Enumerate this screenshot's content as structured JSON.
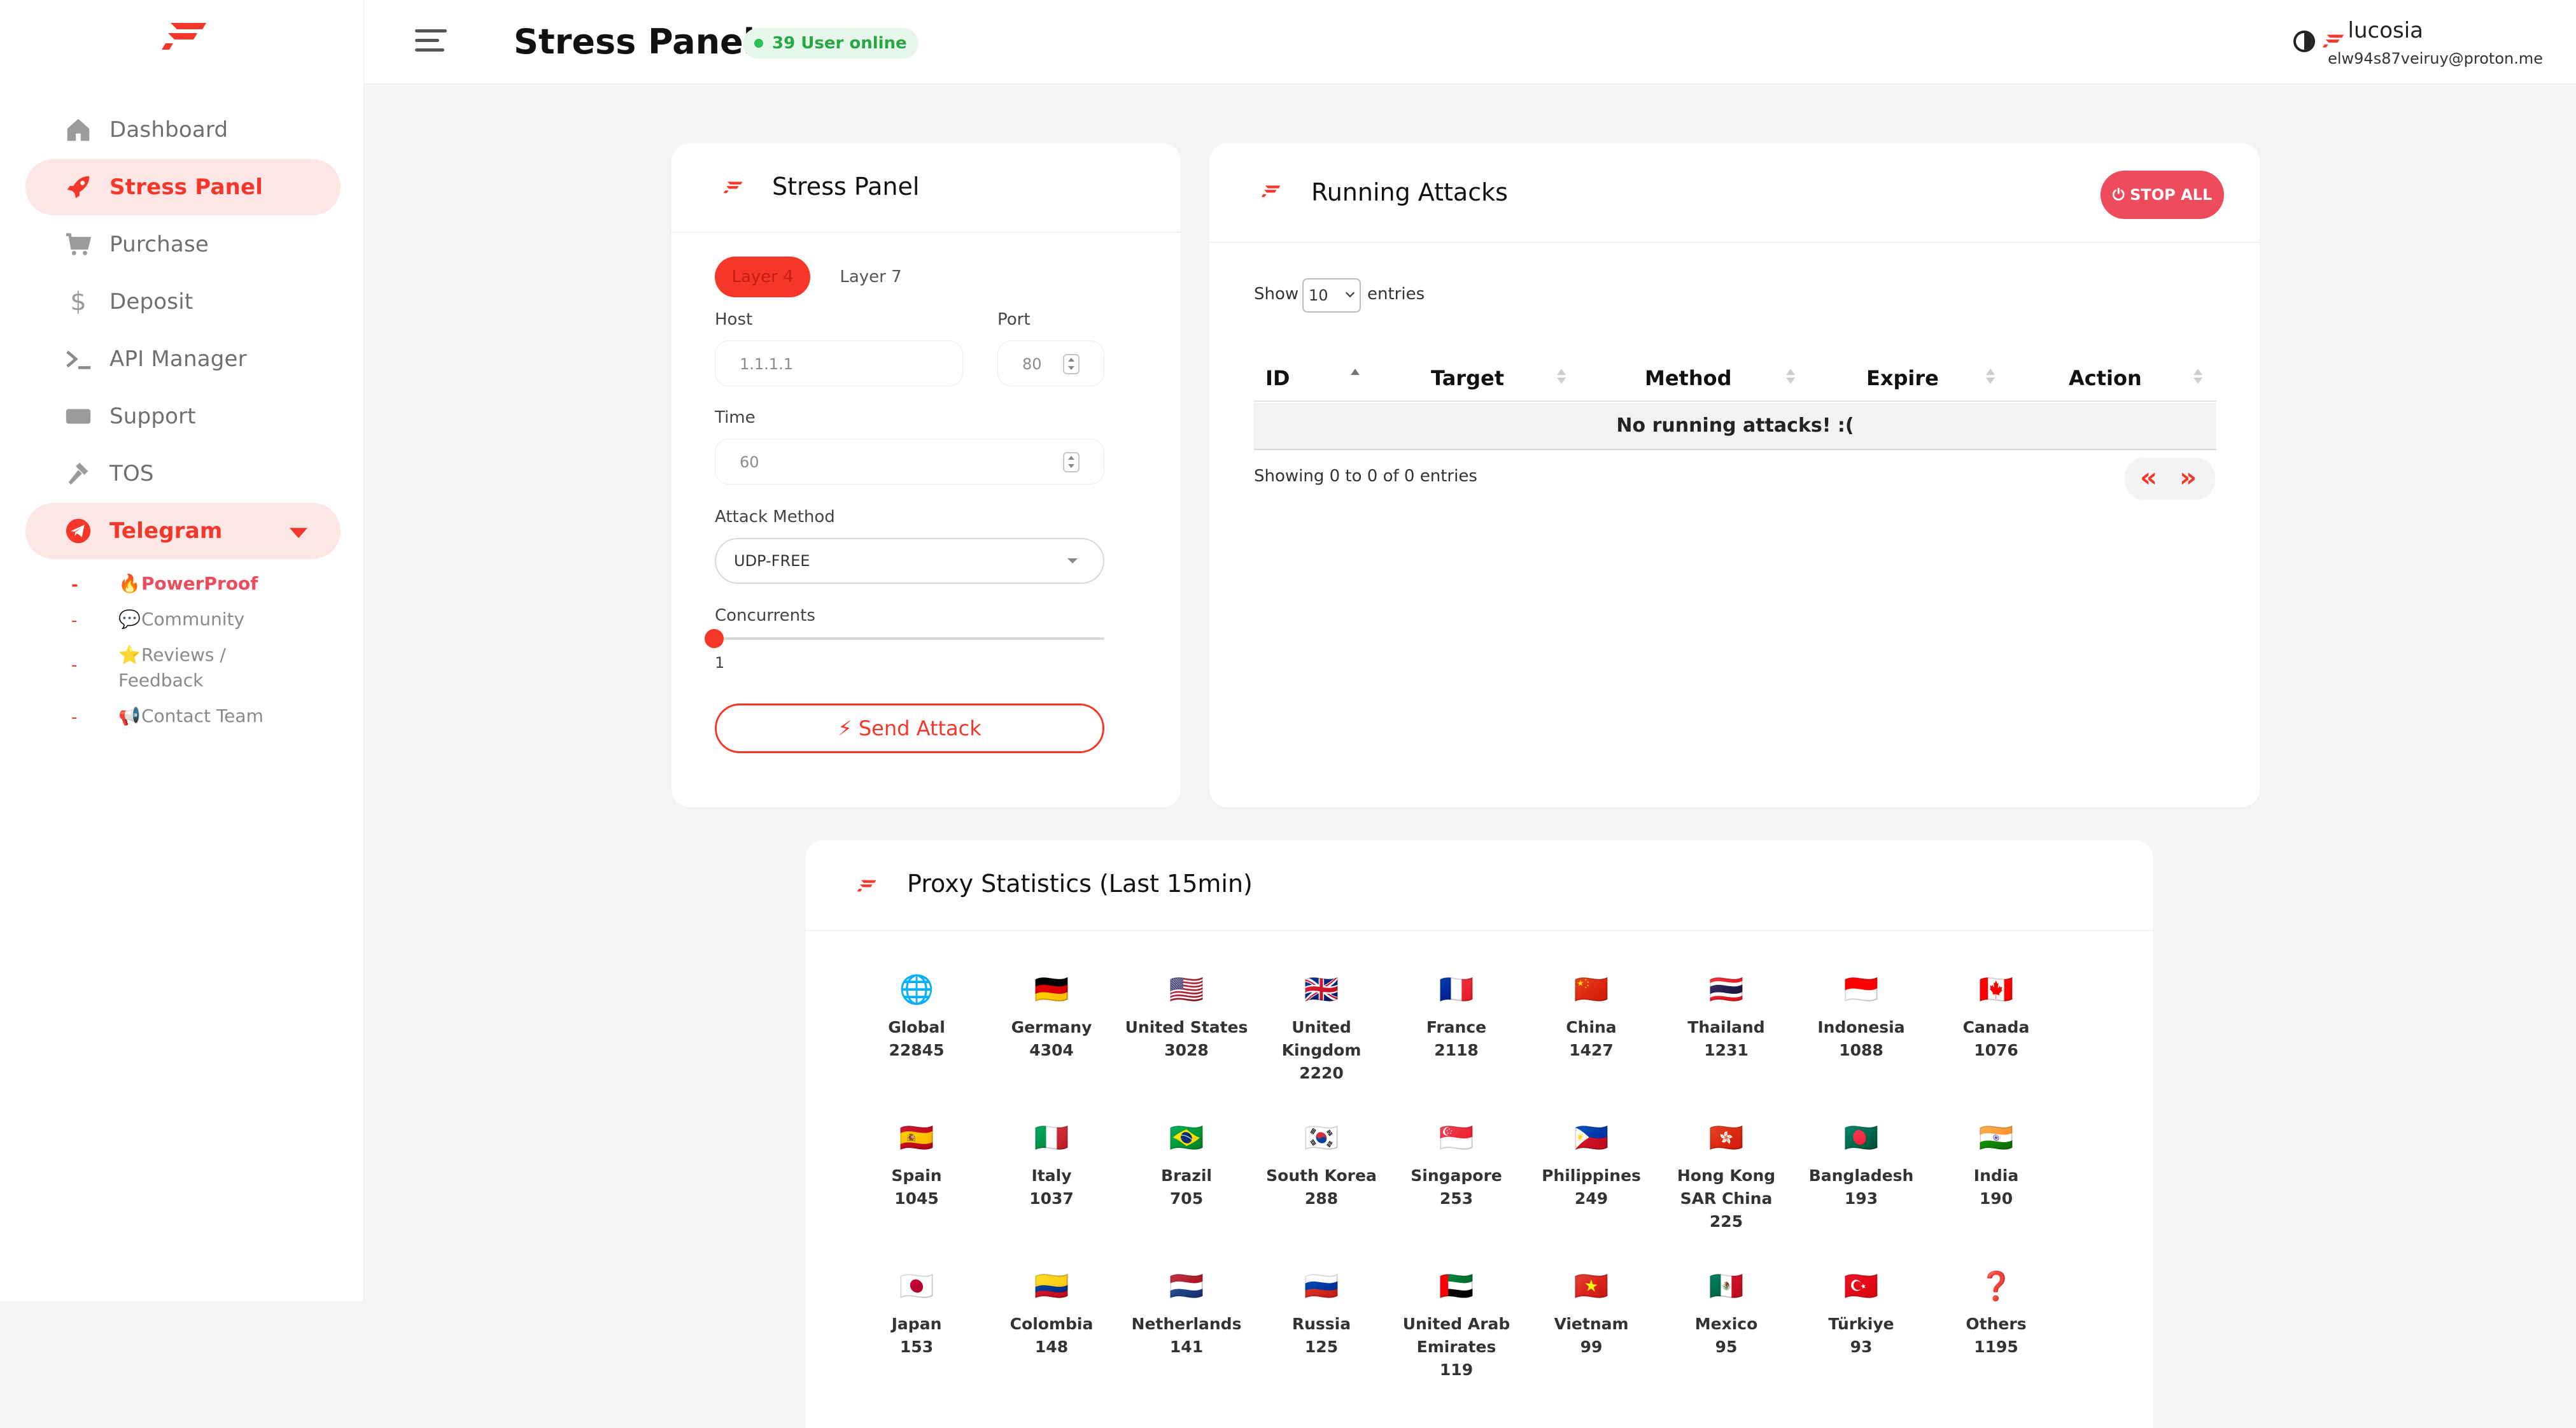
{
  "header": {
    "title": "Stress Panel",
    "online_badge": "39 User online",
    "user_name": "lucosia",
    "user_email": "elw94s87veiruy@proton.me"
  },
  "sidebar": {
    "items": [
      {
        "label": "Dashboard",
        "icon": "home-icon"
      },
      {
        "label": "Stress Panel",
        "icon": "rocket-icon"
      },
      {
        "label": "Purchase",
        "icon": "cart-icon"
      },
      {
        "label": "Deposit",
        "icon": "dollar-icon"
      },
      {
        "label": "API Manager",
        "icon": "terminal-icon"
      },
      {
        "label": "Support",
        "icon": "ticket-icon"
      },
      {
        "label": "TOS",
        "icon": "hammer-icon"
      },
      {
        "label": "Telegram",
        "icon": "telegram-icon"
      }
    ],
    "telegram_sub": [
      {
        "emoji": "🔥",
        "label": "PowerProof"
      },
      {
        "emoji": "💬",
        "label": "Community"
      },
      {
        "emoji": "⭐",
        "label": "Reviews /"
      },
      {
        "emoji": "",
        "label": "Feedback"
      },
      {
        "emoji": "📢",
        "label": "Contact Team"
      }
    ]
  },
  "stress": {
    "title": "Stress Panel",
    "tab_layer4": "Layer 4",
    "tab_layer7": "Layer 7",
    "host_label": "Host",
    "host_placeholder": "1.1.1.1",
    "port_label": "Port",
    "port_value": "80",
    "time_label": "Time",
    "time_value": "60",
    "method_label": "Attack Method",
    "method_value": "UDP-FREE",
    "concurrents_label": "Concurrents",
    "concurrents_value": "1",
    "send_label": "Send Attack"
  },
  "running": {
    "title": "Running Attacks",
    "stop_all": "STOP ALL",
    "show": "Show",
    "entries_value": "10",
    "entries": "entries",
    "columns": [
      "ID",
      "Target",
      "Method",
      "Expire",
      "Action"
    ],
    "empty": "No running attacks! :(",
    "showing": "Showing 0 to 0 of 0 entries"
  },
  "proxy": {
    "title": "Proxy Statistics (Last 15min)",
    "countries": [
      {
        "flag": "🌐",
        "name": "Global",
        "count": "22845"
      },
      {
        "flag": "🇩🇪",
        "name": "Germany",
        "count": "4304"
      },
      {
        "flag": "🇺🇸",
        "name": "United States",
        "count": "3028"
      },
      {
        "flag": "🇬🇧",
        "name": "United Kingdom",
        "count": "2220"
      },
      {
        "flag": "🇫🇷",
        "name": "France",
        "count": "2118"
      },
      {
        "flag": "🇨🇳",
        "name": "China",
        "count": "1427"
      },
      {
        "flag": "🇹🇭",
        "name": "Thailand",
        "count": "1231"
      },
      {
        "flag": "🇮🇩",
        "name": "Indonesia",
        "count": "1088"
      },
      {
        "flag": "🇨🇦",
        "name": "Canada",
        "count": "1076"
      },
      {
        "flag": "🇪🇸",
        "name": "Spain",
        "count": "1045"
      },
      {
        "flag": "🇮🇹",
        "name": "Italy",
        "count": "1037"
      },
      {
        "flag": "🇧🇷",
        "name": "Brazil",
        "count": "705"
      },
      {
        "flag": "🇰🇷",
        "name": "South Korea",
        "count": "288"
      },
      {
        "flag": "🇸🇬",
        "name": "Singapore",
        "count": "253"
      },
      {
        "flag": "🇵🇭",
        "name": "Philippines",
        "count": "249"
      },
      {
        "flag": "🇭🇰",
        "name": "Hong Kong SAR China",
        "count": "225"
      },
      {
        "flag": "🇧🇩",
        "name": "Bangladesh",
        "count": "193"
      },
      {
        "flag": "🇮🇳",
        "name": "India",
        "count": "190"
      },
      {
        "flag": "🇯🇵",
        "name": "Japan",
        "count": "153"
      },
      {
        "flag": "🇨🇴",
        "name": "Colombia",
        "count": "148"
      },
      {
        "flag": "🇳🇱",
        "name": "Netherlands",
        "count": "141"
      },
      {
        "flag": "🇷🇺",
        "name": "Russia",
        "count": "125"
      },
      {
        "flag": "🇦🇪",
        "name": "United Arab Emirates",
        "count": "119"
      },
      {
        "flag": "🇻🇳",
        "name": "Vietnam",
        "count": "99"
      },
      {
        "flag": "🇲🇽",
        "name": "Mexico",
        "count": "95"
      },
      {
        "flag": "🇹🇷",
        "name": "Türkiye",
        "count": "93"
      },
      {
        "flag": "❓",
        "name": "Others",
        "count": "1195"
      }
    ]
  },
  "colors": {
    "accent": "#f5372a",
    "accent_soft": "#fde6e6",
    "online": "#27a844"
  }
}
